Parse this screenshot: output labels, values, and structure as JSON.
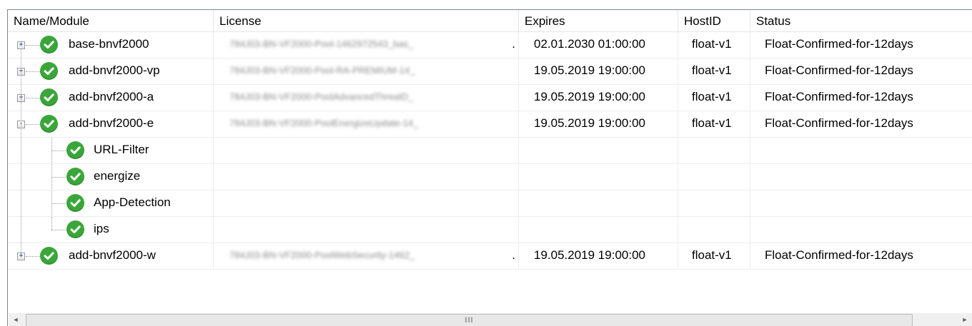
{
  "columns": [
    {
      "key": "name",
      "label": "Name/Module"
    },
    {
      "key": "license",
      "label": "License"
    },
    {
      "key": "expires",
      "label": "Expires"
    },
    {
      "key": "hostid",
      "label": "HostID"
    },
    {
      "key": "status",
      "label": "Status"
    }
  ],
  "rows": [
    {
      "name": "base-bnvf2000",
      "license": "784J03-BN-VF2000-Pool-1462972543_bas_",
      "license_suffix": ".",
      "expires": "02.01.2030 01:00:00",
      "hostid": "float-v1",
      "status": "Float-Confirmed-for-12days",
      "expander": "+",
      "status_icon": "check-icon"
    },
    {
      "name": "add-bnvf2000-vp",
      "license": "784J03-BN-VF2000-Pool-RA-PREMIUM-14_",
      "license_suffix": "",
      "expires": "19.05.2019 19:00:00",
      "hostid": "float-v1",
      "status": "Float-Confirmed-for-12days",
      "expander": "+",
      "status_icon": "check-icon"
    },
    {
      "name": "add-bnvf2000-a",
      "license": "784J03-BN-VF2000-PoolAdvancedThreatD_",
      "license_suffix": "",
      "expires": "19.05.2019 19:00:00",
      "hostid": "float-v1",
      "status": "Float-Confirmed-for-12days",
      "expander": "+",
      "status_icon": "check-icon"
    },
    {
      "name": "add-bnvf2000-e",
      "license": "784J03-BN-VF2000-PoolEnergizeUpdate-14_",
      "license_suffix": "",
      "expires": "19.05.2019 19:00:00",
      "hostid": "float-v1",
      "status": "Float-Confirmed-for-12days",
      "expander": "-",
      "status_icon": "check-icon",
      "children": [
        {
          "name": "URL-Filter",
          "status_icon": "check-icon"
        },
        {
          "name": "energize",
          "status_icon": "check-icon"
        },
        {
          "name": "App-Detection",
          "status_icon": "check-icon"
        },
        {
          "name": "ips",
          "status_icon": "check-icon"
        }
      ]
    },
    {
      "name": "add-bnvf2000-w",
      "license": "784J03-BN-VF2000-PoolWebSecurity-1462_",
      "license_suffix": ".",
      "expires": "19.05.2019 19:00:00",
      "hostid": "float-v1",
      "status": "Float-Confirmed-for-12days",
      "expander": "+",
      "status_icon": "check-icon"
    }
  ],
  "scrollbar": {
    "left_arrow": "◄",
    "right_arrow": "►",
    "grip": "III"
  },
  "colors": {
    "check_green": "#3aa63a",
    "tree_line": "#9a9a9a",
    "grid_line": "#ececec"
  }
}
